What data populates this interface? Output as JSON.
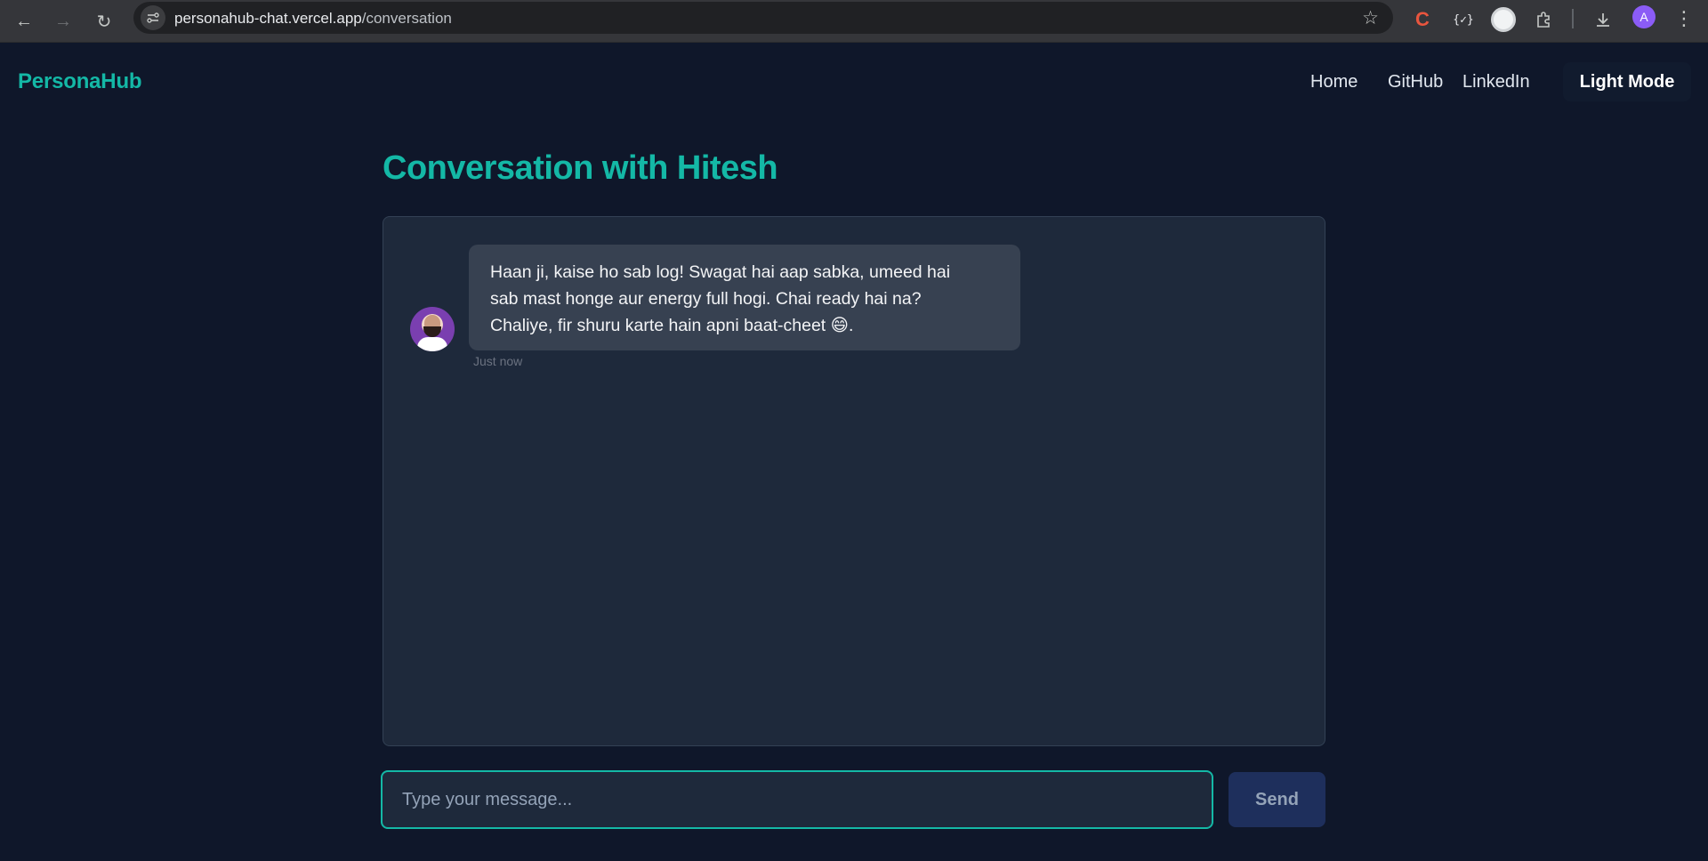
{
  "browser": {
    "url_host": "personahub-chat.vercel.app",
    "url_path": "/conversation",
    "profile_initial": "A",
    "json_ext_label": "{✓}"
  },
  "header": {
    "brand": "PersonaHub",
    "nav": [
      "Home",
      "GitHub",
      "LinkedIn"
    ],
    "mode_toggle": "Light Mode"
  },
  "main": {
    "title": "Conversation with Hitesh",
    "messages": [
      {
        "lines": [
          "Haan ji, kaise ho sab log! Swagat hai aap sabka, umeed hai",
          "sab mast honge aur energy full hogi. Chai ready hai na?",
          "Chaliye, fir shuru karte hain apni baat-cheet 😄."
        ],
        "time": "Just now"
      }
    ],
    "input_placeholder": "Type your message...",
    "input_value": "",
    "send_label": "Send"
  },
  "colors": {
    "accent": "#14b8a6",
    "background": "#0f172a",
    "panel": "#1e293b",
    "bubble": "#374151"
  }
}
